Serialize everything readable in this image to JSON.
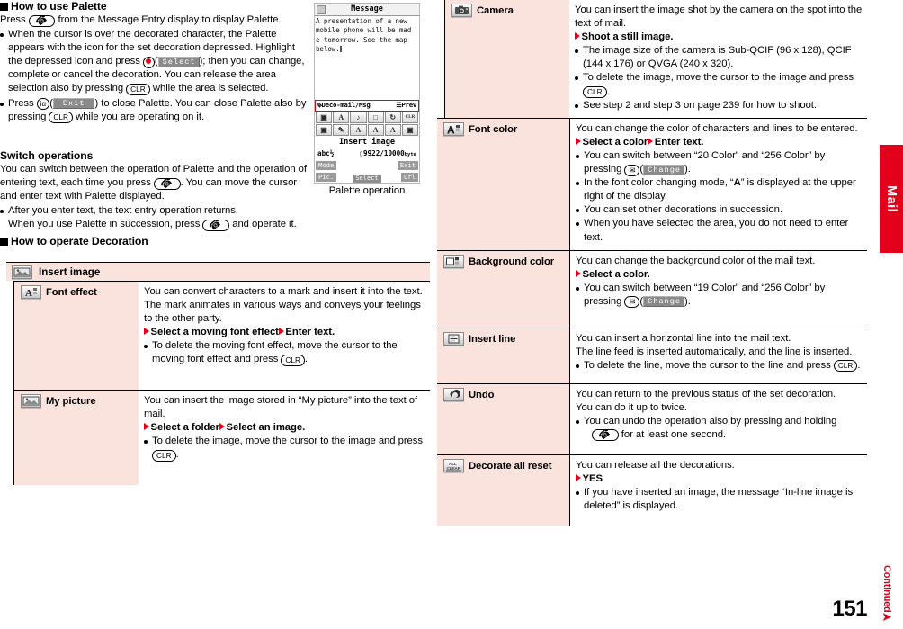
{
  "page": {
    "number": "151",
    "continued_label": "Continued",
    "edge_tab": "Mail"
  },
  "left": {
    "section1_title": "How to use Palette",
    "intro": "Press ",
    "intro_end": " from the Message Entry display to display Palette.",
    "bullets": [
      {
        "parts": [
          "When the cursor is over the decorated character, the Palette appears with the icon for the set decoration depressed. Highlight the depressed icon and press ",
          "(",
          "Select",
          "); then you can change, complete or cancel the decoration. You can release the area selection also by pressing ",
          "CLR",
          " while the area is selected."
        ]
      },
      {
        "parts": [
          "Press ",
          "iα",
          "(",
          "Exit",
          ") to close Palette. You can close Palette also by pressing ",
          "CLR",
          " while you are operating on it."
        ]
      }
    ],
    "switch_title": "Switch operations",
    "switch_body_a": "You can switch between the operation of Palette and the operation of entering text, each time you press ",
    "switch_body_b": ". You can move the cursor and enter text with Palette displayed.",
    "switch_bullet_a": "After you enter text, the text entry operation returns.",
    "switch_bullet_b": "When you use Palette in succession, press ",
    "switch_bullet_c": " and operate it.",
    "section2_title": "How to operate Decoration"
  },
  "phone": {
    "title": "Message",
    "body_lines": [
      "A presentation of a new",
      "mobile phone will be mad",
      "e tomorrow. See the map",
      "below."
    ],
    "menu_left": "Deco-mail/Msg",
    "menu_right": "Prev",
    "status_label": "Insert image",
    "status_left": "abc½",
    "status_right": "9922/10000",
    "status_right_unit": "byte",
    "soft_mode": "Mode",
    "soft_exit": "Exit",
    "soft_pic": "Pic.",
    "soft_url": "Url",
    "soft_select": "Select",
    "caption": "Palette operation",
    "palette_row1": [
      "img",
      "A",
      "J",
      "□",
      "↺",
      "clr"
    ],
    "palette_row2": [
      "□",
      "☂",
      "A",
      "A",
      "A",
      "□"
    ]
  },
  "table_left": {
    "header": {
      "icon": "insert-image-icon",
      "label": "Insert image"
    },
    "rows": [
      {
        "icon": "font-effect-icon",
        "label": "Font effect",
        "lines": [
          {
            "type": "text",
            "text": "You can convert characters to a mark and insert it into the text. The mark animates in various ways and conveys your feelings to the other party."
          },
          {
            "type": "steps",
            "steps": [
              "Select a moving font effect",
              "Enter text."
            ]
          },
          {
            "type": "bullet_clr",
            "before": "To delete the moving font effect, move the cursor to the moving font effect and press ",
            "key": "CLR",
            "after": "."
          }
        ]
      },
      {
        "icon": "my-picture-icon",
        "label": "My picture",
        "lines": [
          {
            "type": "text",
            "text": "You can insert the image stored in “My picture” into the text of mail."
          },
          {
            "type": "steps",
            "steps": [
              "Select a folder",
              "Select an image."
            ]
          },
          {
            "type": "bullet_clr",
            "before": "To delete the image, move the cursor to the image and press ",
            "key": "CLR",
            "after": "."
          }
        ]
      }
    ]
  },
  "table_right": {
    "rows": [
      {
        "icon": "camera-icon",
        "label": "Camera",
        "lines": [
          {
            "type": "text",
            "text": "You can insert the image shot by the camera on the spot into the text of mail."
          },
          {
            "type": "steps",
            "steps": [
              "Shoot a still image."
            ]
          },
          {
            "type": "bullet",
            "text": "The image size of the camera is Sub-QCIF (96 x 128), QCIF (144 x 176) or QVGA (240 x 320)."
          },
          {
            "type": "bullet_clr",
            "before": "To delete the image, move the cursor to the image and press ",
            "key": "CLR",
            "after": "."
          },
          {
            "type": "bullet",
            "text": "See step 2 and step 3 on page 239 for how to shoot."
          }
        ]
      },
      {
        "icon": "font-color-icon",
        "label": "Font color",
        "lines": [
          {
            "type": "text",
            "text": "You can change the color of characters and lines to be entered."
          },
          {
            "type": "steps",
            "steps": [
              "Select a color",
              "Enter text."
            ]
          },
          {
            "type": "bullet_change",
            "before": "You can switch between “20 Color” and “256 Color” by pressing ",
            "softkey": "Change",
            "after": "."
          },
          {
            "type": "bullet_fontmode",
            "before": "In the font color changing mode, “",
            "glyph": "A",
            "after": "” is displayed at the upper right of the display."
          },
          {
            "type": "bullet",
            "text": "You can set other decorations in succession."
          },
          {
            "type": "bullet",
            "text": "When you have selected the area, you do not need to enter text."
          }
        ]
      },
      {
        "icon": "background-color-icon",
        "label": "Background color",
        "lines": [
          {
            "type": "text",
            "text": "You can change the background color of the mail text."
          },
          {
            "type": "steps",
            "steps": [
              "Select a color."
            ]
          },
          {
            "type": "bullet_change",
            "before": "You can switch between “19 Color” and “256 Color” by pressing ",
            "softkey": "Change",
            "after": "."
          }
        ]
      },
      {
        "icon": "insert-line-icon",
        "label": "Insert line",
        "lines": [
          {
            "type": "text",
            "text": "You can insert a horizontal line into the mail text."
          },
          {
            "type": "text",
            "text": "The line feed is inserted automatically, and the line is inserted."
          },
          {
            "type": "bullet_clr",
            "before": "To delete the line, move the cursor to the line and press ",
            "key": "CLR",
            "after": "."
          }
        ]
      },
      {
        "icon": "undo-icon",
        "label": "Undo",
        "lines": [
          {
            "type": "text",
            "text": "You can return to the previous status of the set decoration."
          },
          {
            "type": "text",
            "text": "You can do it up to twice."
          },
          {
            "type": "bullet_call",
            "before": "You can undo the operation also by pressing and holding ",
            "after": " for at least one second."
          }
        ]
      },
      {
        "icon": "decorate-all-reset-icon",
        "label": "Decorate all reset",
        "lines": [
          {
            "type": "text",
            "text": "You can release all the decorations."
          },
          {
            "type": "steps",
            "steps": [
              "YES"
            ]
          },
          {
            "type": "bullet",
            "text": "If you have inserted an image, the message “In-line image is deleted” is displayed."
          }
        ]
      }
    ]
  },
  "colors": {
    "accent_red": "#e2001a",
    "row_pink": "#fbe3dd",
    "softkey_gray": "#8a8a8a"
  }
}
